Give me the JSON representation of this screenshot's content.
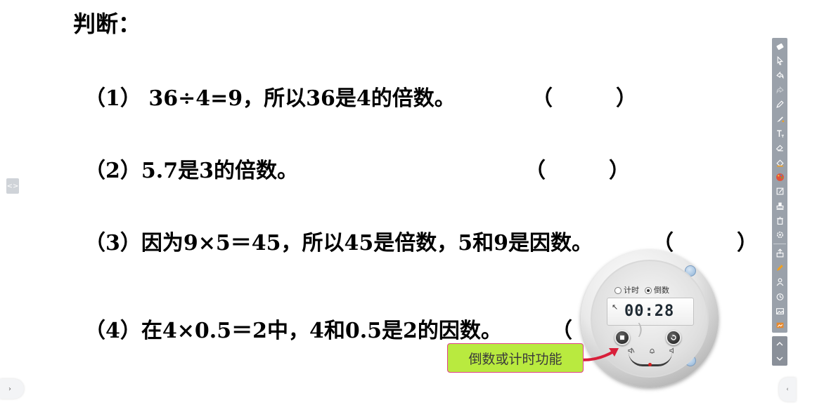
{
  "title": "判断：",
  "questions": [
    {
      "text": "（1） 36÷4=9，所以36是4的倍数。",
      "paren": "（　　　）"
    },
    {
      "text": "（2）5.7是3的倍数。",
      "paren": "（　　　）"
    },
    {
      "text": "（3）因为9×5＝45，所以45是倍数，5和9是因数。",
      "paren": "（　　　）"
    },
    {
      "text": "（4）在4×0.5＝2中，4和0.5是2的因数。",
      "paren": "（"
    }
  ],
  "left_expander": "<>",
  "left_bottom_tab": "›",
  "right_bottom_tab": "‹",
  "timer": {
    "mode_options": [
      "计时",
      "倒数"
    ],
    "selected_mode": "倒数",
    "display": "00:28"
  },
  "callout": "倒数或计时功能",
  "toolbar_icons": [
    "eraser-icon",
    "cursor-icon",
    "undo-icon",
    "redo-icon",
    "pen-icon",
    "highlighter-icon",
    "text-icon",
    "eraser-icon",
    "fill-icon",
    "palette-icon",
    "edit-icon",
    "stamp-icon",
    "trash-icon",
    "settings-icon",
    "export-icon",
    "pencil-icon",
    "user-icon",
    "timer-icon",
    "image-icon",
    "screenshot-icon"
  ],
  "colors": {
    "toolbar": "#9aa1aa",
    "callout_fill": "#b9ea3f",
    "callout_border": "#e0408a",
    "arrow": "#d81f3a"
  }
}
